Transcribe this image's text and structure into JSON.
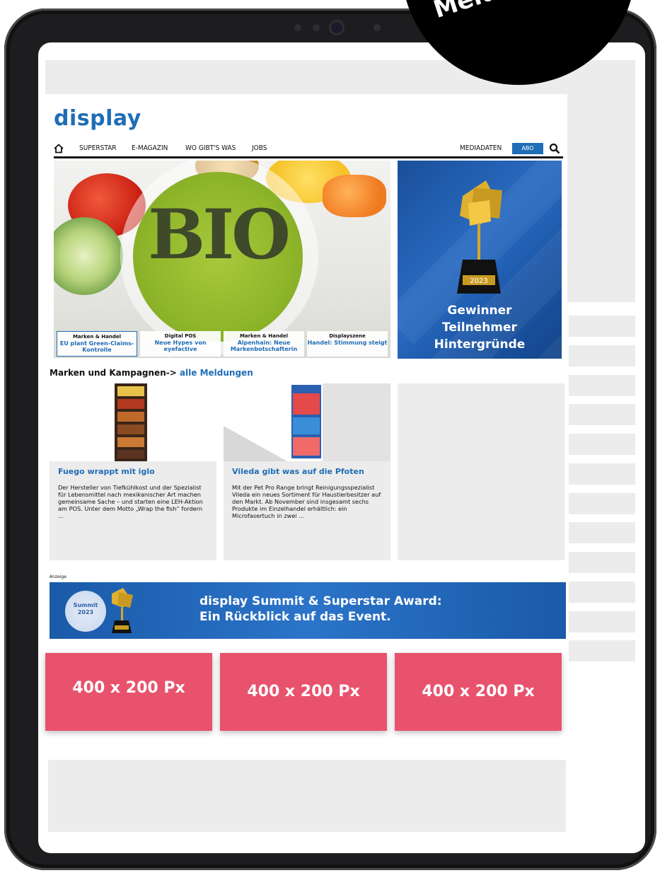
{
  "badge": {
    "label": "Meldung"
  },
  "site": {
    "logo": "display",
    "nav": {
      "items": [
        "SUPERSTAR",
        "E-MAGAZIN",
        "WO GIBT'S WAS",
        "JOBS"
      ],
      "mediadaten": "MEDIADATEN",
      "abo": "ABO"
    }
  },
  "hero": {
    "image_text": "BIO",
    "teasers": [
      {
        "category": "Marken & Handel",
        "title": "EU plant Green-Claims-Kontrolle"
      },
      {
        "category": "Digital POS",
        "title": "Neue Hypes von eyefactive"
      },
      {
        "category": "Marken & Handel",
        "title": "Alpenhain: Neue Markenbotschafterin"
      },
      {
        "category": "Displayszene",
        "title": "Handel: Stimmung steigt"
      }
    ]
  },
  "award": {
    "year": "2023",
    "lines": [
      "Gewinner",
      "Teilnehmer",
      "Hintergründe"
    ]
  },
  "section": {
    "title": "Marken und Kampagnen-> ",
    "link": "alle Meldungen"
  },
  "articles": [
    {
      "title": "Fuego wrappt mit iglo",
      "body": "Der Hersteller von Tiefkühlkost und der Spezialist für Lebensmittel nach mexikanischer Art machen gemeinsame Sache – und starten eine LEH-Aktion am POS. Unter dem Motto „Wrap the fish“ fordern ..."
    },
    {
      "title": "Vileda gibt was auf die Pfoten",
      "body": "Mit der Pet Pro Range bringt Reinigungsspezialist Vileda ein neues Sortiment für Haustierbesitzer auf den Markt. Ab November sind insgesamt sechs Produkte im Einzelhandel erhältlich: ein Microfasertuch in zwei ..."
    }
  ],
  "ad_banner": {
    "label": "Anzeige",
    "summit_badge": "Summit 2023",
    "line1": "display Summit & Superstar Award:",
    "line2": "Ein Rückblick auf das Event."
  },
  "ad_slots": [
    "400 x 200 Px",
    "400 x 200 Px",
    "400 x 200 Px"
  ]
}
